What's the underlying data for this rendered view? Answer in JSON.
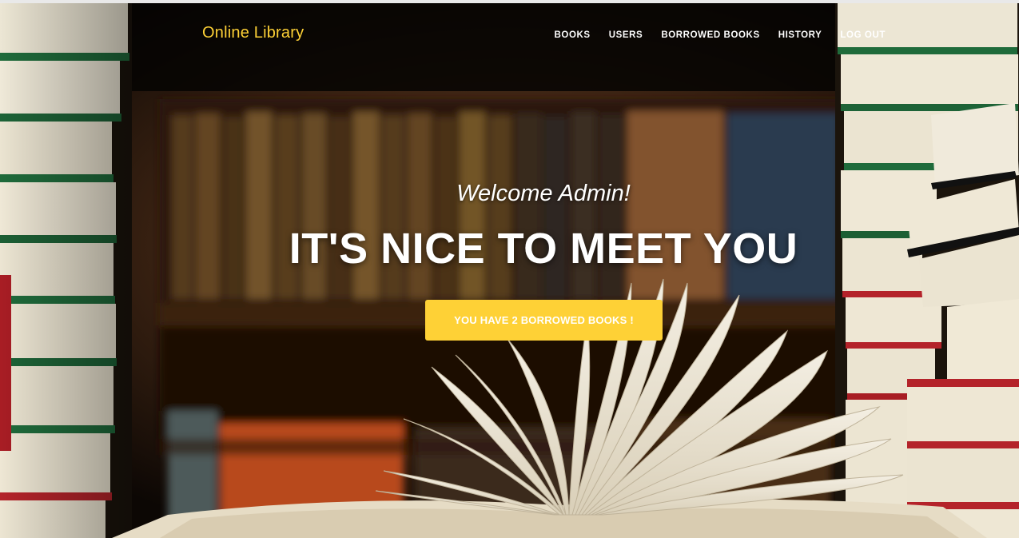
{
  "navbar": {
    "brand": "Online Library",
    "items": [
      {
        "label": "BOOKS"
      },
      {
        "label": "USERS"
      },
      {
        "label": "BORROWED BOOKS"
      },
      {
        "label": "HISTORY"
      },
      {
        "label": "LOG OUT"
      }
    ]
  },
  "hero": {
    "subheading": "Welcome Admin!",
    "heading": "IT'S NICE TO MEET YOU",
    "button_label": "YOU HAVE 2 BORROWED BOOKS !"
  },
  "colors": {
    "accent": "#fed136",
    "text": "#ffffff",
    "dark_background": "#120b06"
  },
  "background": {
    "depicts": "library-books-photo"
  }
}
